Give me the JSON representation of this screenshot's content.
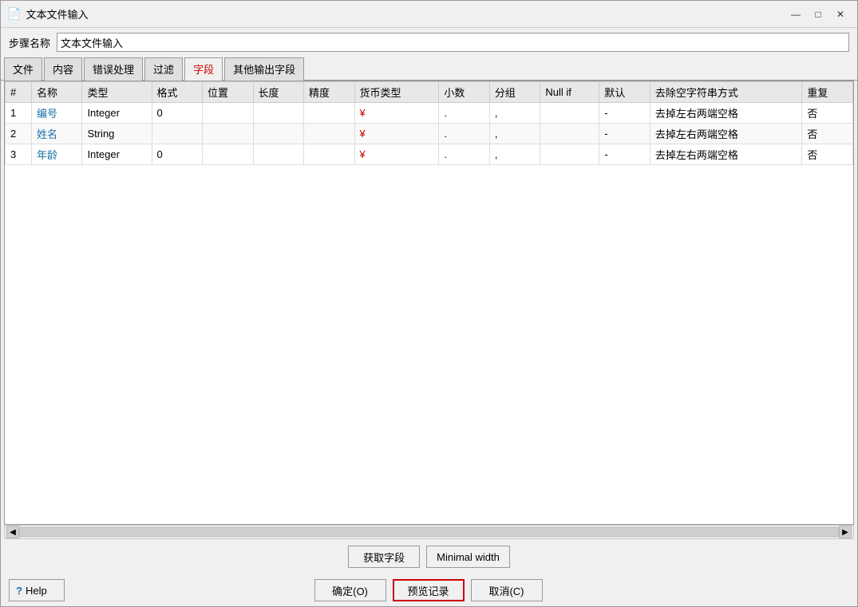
{
  "window": {
    "title": "文本文件输入",
    "icon": "📄"
  },
  "title_controls": {
    "minimize": "—",
    "maximize": "□",
    "close": "✕"
  },
  "step_name": {
    "label": "步骤名称",
    "value": "文本文件输入"
  },
  "tabs": [
    {
      "id": "file",
      "label": "文件",
      "active": false
    },
    {
      "id": "content",
      "label": "内容",
      "active": false
    },
    {
      "id": "error",
      "label": "错误处理",
      "active": false
    },
    {
      "id": "filter",
      "label": "过滤",
      "active": false
    },
    {
      "id": "fields",
      "label": "字段",
      "active": true
    },
    {
      "id": "other",
      "label": "其他输出字段",
      "active": false
    }
  ],
  "table": {
    "headers": [
      "#",
      "名称",
      "类型",
      "格式",
      "位置",
      "长度",
      "精度",
      "货币类型",
      "小数",
      "分组",
      "Null if",
      "默认",
      "去除空字符串方式",
      "重复"
    ],
    "rows": [
      {
        "num": "1",
        "name": "编号",
        "type": "Integer",
        "format": "0",
        "position": "",
        "length": "",
        "precision": "",
        "currency": "¥",
        "decimal": ".",
        "group": ",",
        "null_if": "",
        "default": "-",
        "trim": "去掉左右两端空格",
        "repeat": "否"
      },
      {
        "num": "2",
        "name": "姓名",
        "type": "String",
        "format": "",
        "position": "",
        "length": "",
        "precision": "",
        "currency": "¥",
        "decimal": ".",
        "group": ",",
        "null_if": "",
        "default": "-",
        "trim": "去掉左右两端空格",
        "repeat": "否"
      },
      {
        "num": "3",
        "name": "年龄",
        "type": "Integer",
        "format": "0",
        "position": "",
        "length": "",
        "precision": "",
        "currency": "¥",
        "decimal": ".",
        "group": ",",
        "null_if": "",
        "default": "-",
        "trim": "去掉左右两端空格",
        "repeat": "否"
      }
    ]
  },
  "buttons": {
    "get_fields": "获取字段",
    "minimal_width": "Minimal width",
    "ok": "确定(O)",
    "preview": "预览记录",
    "cancel": "取消(C)",
    "help": "Help"
  }
}
